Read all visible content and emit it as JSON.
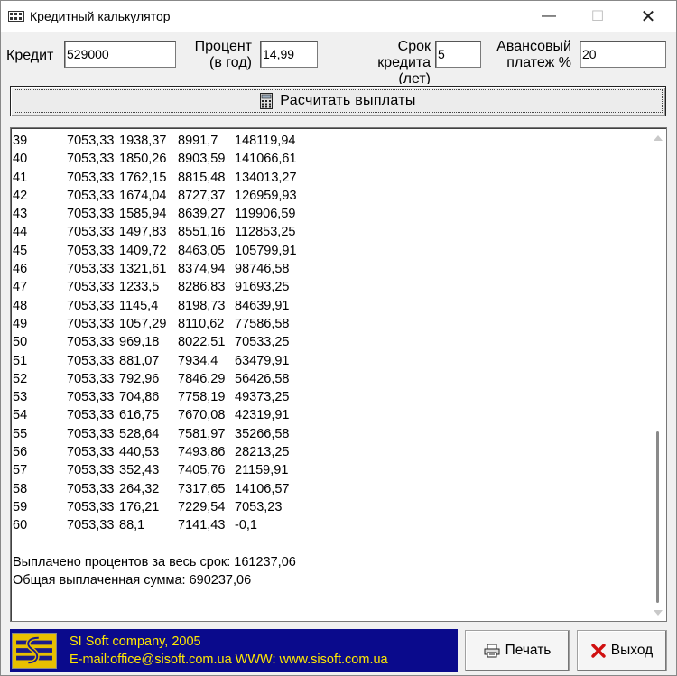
{
  "window": {
    "title": "Кредитный калькулятор",
    "minimize_glyph": "—",
    "maximize_glyph": "☐",
    "close_glyph": "✕"
  },
  "inputs": {
    "credit_label": "Кредит",
    "credit_value": "529000",
    "percent_label_line1": "Процент",
    "percent_label_line2": "(в год)",
    "percent_value": "14,99",
    "term_label_line1": "Срок",
    "term_label_line2": "кредита",
    "term_label_line3": "(лет)",
    "term_value": "5",
    "advance_label_line1": "Авансовый",
    "advance_label_line2": "платеж %",
    "advance_value": "20"
  },
  "calculate_button": {
    "label": "Расчитать выплаты",
    "icon": "calculator-icon"
  },
  "table": {
    "rows": [
      [
        "39",
        "7053,33",
        "1938,37",
        "8991,7",
        "148119,94"
      ],
      [
        "40",
        "7053,33",
        "1850,26",
        "8903,59",
        "141066,61"
      ],
      [
        "41",
        "7053,33",
        "1762,15",
        "8815,48",
        "134013,27"
      ],
      [
        "42",
        "7053,33",
        "1674,04",
        "8727,37",
        "126959,93"
      ],
      [
        "43",
        "7053,33",
        "1585,94",
        "8639,27",
        "119906,59"
      ],
      [
        "44",
        "7053,33",
        "1497,83",
        "8551,16",
        "112853,25"
      ],
      [
        "45",
        "7053,33",
        "1409,72",
        "8463,05",
        "105799,91"
      ],
      [
        "46",
        "7053,33",
        "1321,61",
        "8374,94",
        "98746,58"
      ],
      [
        "47",
        "7053,33",
        "1233,5",
        "8286,83",
        "91693,25"
      ],
      [
        "48",
        "7053,33",
        "1145,4",
        "8198,73",
        "84639,91"
      ],
      [
        "49",
        "7053,33",
        "1057,29",
        "8110,62",
        "77586,58"
      ],
      [
        "50",
        "7053,33",
        "969,18",
        "8022,51",
        "70533,25"
      ],
      [
        "51",
        "7053,33",
        "881,07",
        "7934,4",
        "63479,91"
      ],
      [
        "52",
        "7053,33",
        "792,96",
        "7846,29",
        "56426,58"
      ],
      [
        "53",
        "7053,33",
        "704,86",
        "7758,19",
        "49373,25"
      ],
      [
        "54",
        "7053,33",
        "616,75",
        "7670,08",
        "42319,91"
      ],
      [
        "55",
        "7053,33",
        "528,64",
        "7581,97",
        "35266,58"
      ],
      [
        "56",
        "7053,33",
        "440,53",
        "7493,86",
        "28213,25"
      ],
      [
        "57",
        "7053,33",
        "352,43",
        "7405,76",
        "21159,91"
      ],
      [
        "58",
        "7053,33",
        "264,32",
        "7317,65",
        "14106,57"
      ],
      [
        "59",
        "7053,33",
        "176,21",
        "7229,54",
        "7053,23"
      ],
      [
        "60",
        "7053,33",
        "88,1",
        "7141,43",
        "-0,1"
      ]
    ],
    "summary_interest": "Выплачено процентов за весь срок: 161237,06",
    "summary_total": "Общая выплаченная сумма: 690237,06"
  },
  "banner": {
    "line1": "SI Soft company, 2005",
    "line2": "E-mail:office@sisoft.com.ua  WWW:  www.sisoft.com.ua",
    "logo": "si-soft-logo"
  },
  "buttons": {
    "print_label": "Печать",
    "print_icon": "printer-icon",
    "exit_label": "Выход",
    "exit_icon": "x-icon"
  },
  "colors": {
    "banner_bg": "#0a0a8c",
    "banner_text": "#ffe800",
    "logo_bg": "#e8c000",
    "exit_icon": "#d01010"
  }
}
